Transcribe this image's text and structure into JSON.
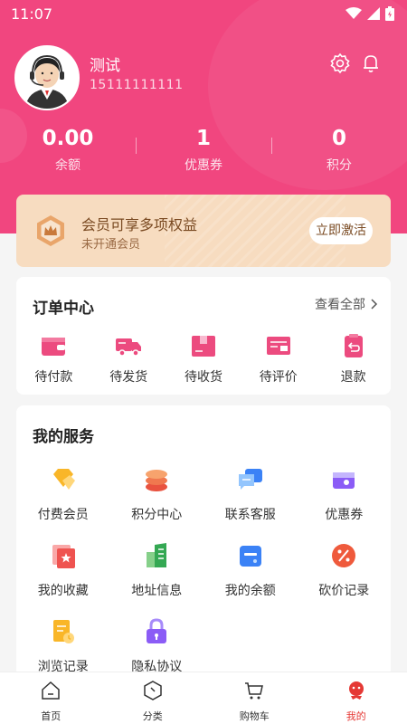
{
  "status_bar": {
    "time": "11:07"
  },
  "profile": {
    "name": "测试",
    "phone": "15111111111"
  },
  "stats": [
    {
      "value": "0.00",
      "label": "余额"
    },
    {
      "value": "1",
      "label": "优惠券"
    },
    {
      "value": "0",
      "label": "积分"
    }
  ],
  "vip": {
    "title": "会员可享多项权益",
    "subtitle": "未开通会员",
    "button": "立即激活"
  },
  "orders": {
    "title": "订单中心",
    "more": "查看全部",
    "items": [
      {
        "label": "待付款",
        "icon": "wallet-icon"
      },
      {
        "label": "待发货",
        "icon": "truck-icon"
      },
      {
        "label": "待收货",
        "icon": "box-icon"
      },
      {
        "label": "待评价",
        "icon": "review-icon"
      },
      {
        "label": "退款",
        "icon": "refund-icon"
      }
    ]
  },
  "services": {
    "title": "我的服务",
    "items": [
      {
        "label": "付费会员",
        "icon": "diamond-icon"
      },
      {
        "label": "积分中心",
        "icon": "coins-icon"
      },
      {
        "label": "联系客服",
        "icon": "chat-icon"
      },
      {
        "label": "优惠券",
        "icon": "coupon-icon"
      },
      {
        "label": "我的收藏",
        "icon": "favorite-icon"
      },
      {
        "label": "地址信息",
        "icon": "building-icon"
      },
      {
        "label": "我的余额",
        "icon": "card-icon"
      },
      {
        "label": "砍价记录",
        "icon": "percent-icon"
      },
      {
        "label": "浏览记录",
        "icon": "history-icon"
      },
      {
        "label": "隐私协议",
        "icon": "lock-icon"
      }
    ]
  },
  "tabbar": [
    {
      "label": "首页",
      "icon": "home-icon"
    },
    {
      "label": "分类",
      "icon": "category-icon"
    },
    {
      "label": "购物车",
      "icon": "cart-icon"
    },
    {
      "label": "我的",
      "icon": "mine-icon",
      "active": true
    }
  ],
  "colors": {
    "brand": "#f1467f",
    "gold": "#f7dcc0",
    "active_tab": "#e53935"
  }
}
